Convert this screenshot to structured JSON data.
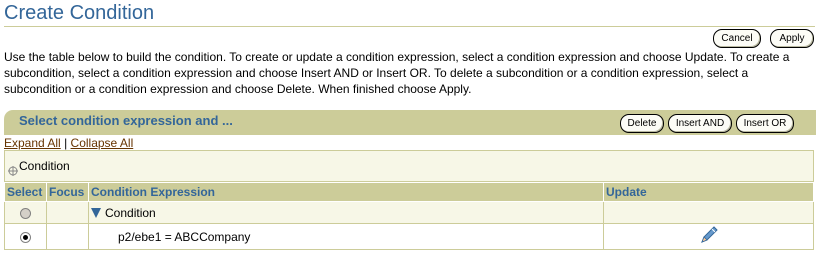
{
  "page": {
    "title": "Create Condition",
    "instructions": "Use the table below to build the condition. To create or update a condition expression, select a condition expression and choose Update. To create a subcondition, select a condition expression and choose Insert AND or Insert OR. To delete a subcondition or a condition expression, select a subcondition or a condition expression and choose Delete. When finished choose Apply."
  },
  "buttons": {
    "cancel": "Cancel",
    "apply": "Apply",
    "delete": "Delete",
    "insert_and": "Insert AND",
    "insert_or": "Insert OR"
  },
  "section": {
    "title": "Select condition expression and ..."
  },
  "links": {
    "expand_all": "Expand All",
    "separator": "|",
    "collapse_all": "Collapse All"
  },
  "tree": {
    "root_label": "Condition"
  },
  "table": {
    "headers": {
      "select": "Select",
      "focus": "Focus",
      "expression": "Condition Expression",
      "update": "Update"
    },
    "rows": [
      {
        "expression": "Condition",
        "selected": false,
        "disabled": true
      },
      {
        "expression": "p2/ebe1 = ABCCompany",
        "selected": true,
        "disabled": false
      }
    ]
  },
  "colors": {
    "accent": "#336699",
    "band": "#cccc99",
    "link": "#663300"
  }
}
